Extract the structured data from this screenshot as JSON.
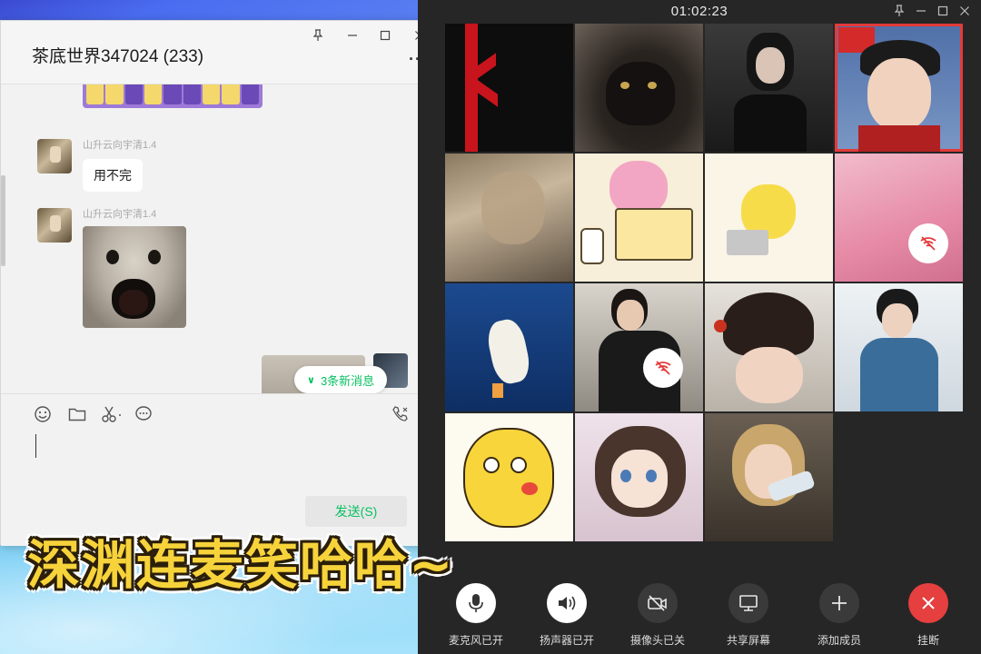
{
  "chat": {
    "title": "茶底世界347024 (233)",
    "window_controls": [
      "pin-icon",
      "minimize-icon",
      "maximize-icon",
      "close-icon"
    ],
    "more_label": "···",
    "messages": [
      {
        "sender": "山升云向宇清1.4",
        "type": "text",
        "text": "用不完"
      },
      {
        "sender": "山升云向宇清1.4",
        "type": "image"
      }
    ],
    "new_messages_label": "3条新消息",
    "composer_tools": [
      "emoji-icon",
      "folder-icon",
      "scissors-icon",
      "chat-history-icon"
    ],
    "call_tool": "voice-call-icon",
    "send_label": "发送(S)",
    "accent": "#07c160"
  },
  "call": {
    "timer": "01:02:23",
    "window_controls": [
      "pin-icon",
      "minimize-icon",
      "maximize-icon",
      "close-icon"
    ],
    "participants": [
      {
        "id": "p1",
        "muted": false,
        "speaking": false
      },
      {
        "id": "p2",
        "muted": false,
        "speaking": false
      },
      {
        "id": "p3",
        "muted": false,
        "speaking": false
      },
      {
        "id": "p4",
        "muted": false,
        "speaking": true
      },
      {
        "id": "p5",
        "muted": false,
        "speaking": false
      },
      {
        "id": "p6",
        "muted": false,
        "speaking": false
      },
      {
        "id": "p7",
        "muted": false,
        "speaking": false
      },
      {
        "id": "p8",
        "muted": true,
        "speaking": false
      },
      {
        "id": "p9",
        "muted": false,
        "speaking": false
      },
      {
        "id": "p10",
        "muted": true,
        "speaking": false
      },
      {
        "id": "p11",
        "muted": false,
        "speaking": false
      },
      {
        "id": "p12",
        "muted": false,
        "speaking": false
      },
      {
        "id": "p13",
        "muted": false,
        "speaking": false
      },
      {
        "id": "p14",
        "muted": false,
        "speaking": false
      },
      {
        "id": "p15",
        "muted": false,
        "speaking": false
      }
    ],
    "controls": [
      {
        "label": "麦克风已开",
        "icon": "microphone-icon"
      },
      {
        "label": "扬声器已开",
        "icon": "speaker-icon"
      },
      {
        "label": "摄像头已关",
        "icon": "camera-off-icon"
      },
      {
        "label": "共享屏幕",
        "icon": "screen-share-icon"
      },
      {
        "label": "添加成员",
        "icon": "add-member-icon"
      },
      {
        "label": "挂断",
        "icon": "hang-up-icon"
      }
    ],
    "hangup_color": "#e53f3f",
    "speaking_color": "#e33a3a"
  },
  "caption": {
    "text": "深渊连麦笑哈哈~",
    "color": "#f7d33b"
  }
}
